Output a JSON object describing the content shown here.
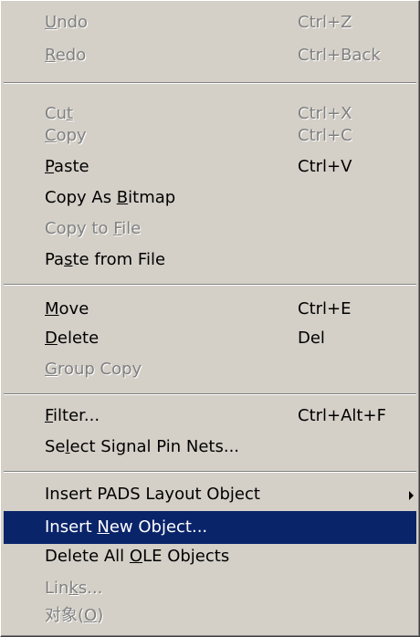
{
  "menu": {
    "items": [
      {
        "id": "undo",
        "label_pre": "",
        "label_u": "U",
        "label_post": "ndo",
        "shortcut": "Ctrl+Z",
        "disabled": true
      },
      {
        "id": "redo",
        "label_pre": "",
        "label_u": "R",
        "label_post": "edo",
        "shortcut": "Ctrl+Back",
        "disabled": true
      },
      {
        "id": "cut",
        "label_pre": "Cu",
        "label_u": "t",
        "label_post": "",
        "shortcut": "Ctrl+X",
        "disabled": true
      },
      {
        "id": "copy",
        "label_pre": "",
        "label_u": "C",
        "label_post": "opy",
        "shortcut": "Ctrl+C",
        "disabled": true
      },
      {
        "id": "paste",
        "label_pre": "",
        "label_u": "P",
        "label_post": "aste",
        "shortcut": "Ctrl+V",
        "disabled": false
      },
      {
        "id": "copy-as-bitmap",
        "label_pre": "Copy As ",
        "label_u": "B",
        "label_post": "itmap",
        "shortcut": "",
        "disabled": false
      },
      {
        "id": "copy-to-file",
        "label_pre": "Copy to ",
        "label_u": "F",
        "label_post": "ile",
        "shortcut": "",
        "disabled": true
      },
      {
        "id": "paste-from-file",
        "label_pre": "Pa",
        "label_u": "s",
        "label_post": "te from File",
        "shortcut": "",
        "disabled": false
      },
      {
        "id": "move",
        "label_pre": "",
        "label_u": "M",
        "label_post": "ove",
        "shortcut": "Ctrl+E",
        "disabled": false
      },
      {
        "id": "delete",
        "label_pre": "",
        "label_u": "D",
        "label_post": "elete",
        "shortcut": "Del",
        "disabled": false
      },
      {
        "id": "group-copy",
        "label_pre": "",
        "label_u": "G",
        "label_post": "roup Copy",
        "shortcut": "",
        "disabled": true
      },
      {
        "id": "filter",
        "label_pre": "",
        "label_u": "F",
        "label_post": "ilter...",
        "shortcut": "Ctrl+Alt+F",
        "disabled": false
      },
      {
        "id": "select-signal-pin-nets",
        "label_pre": "Se",
        "label_u": "l",
        "label_post": "ect Signal Pin Nets...",
        "shortcut": "",
        "disabled": false
      },
      {
        "id": "insert-pads-layout-object",
        "label_pre": "Insert PADS Layout Object",
        "label_u": "",
        "label_post": "",
        "shortcut": "",
        "disabled": false,
        "submenu": true
      },
      {
        "id": "insert-new-object",
        "label_pre": "Insert ",
        "label_u": "N",
        "label_post": "ew Object...",
        "shortcut": "",
        "disabled": false,
        "highlighted": true
      },
      {
        "id": "delete-all-ole-objects",
        "label_pre": "Delete All ",
        "label_u": "O",
        "label_post": "LE Objects",
        "shortcut": "",
        "disabled": false
      },
      {
        "id": "links",
        "label_pre": "Lin",
        "label_u": "k",
        "label_post": "s...",
        "shortcut": "",
        "disabled": true
      },
      {
        "id": "object",
        "label_pre": "对象(",
        "label_u": "O",
        "label_post": ")",
        "shortcut": "",
        "disabled": true
      }
    ]
  }
}
